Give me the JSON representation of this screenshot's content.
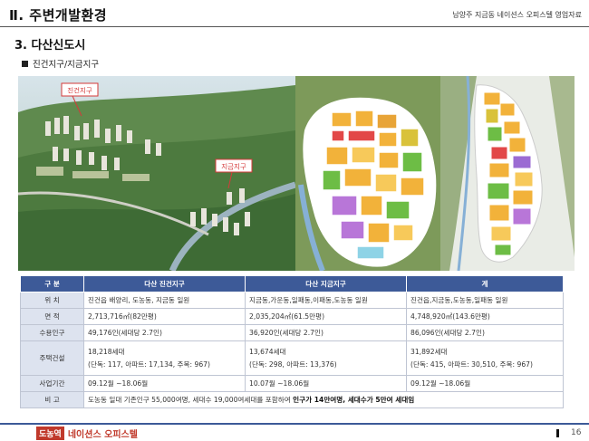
{
  "header": {
    "title": "Ⅱ.  주변개발환경",
    "subtitle": "남양주 지금동 네이션스 오피스텔 영업자료"
  },
  "section": {
    "title": "3. 다산신도시",
    "subsection": "진건지구/지금지구"
  },
  "map_labels": {
    "jingeon": "진건지구",
    "jigeum": "지금지구"
  },
  "table": {
    "headers": [
      "구  분",
      "다산 진건지구",
      "다산 지금지구",
      "계"
    ],
    "rows": [
      {
        "label": "위  치",
        "cells": [
          "진건읍 배양리, 도농동, 지금동 일원",
          "지금동,가운동,일패동,이패동,도농동  일원",
          "진건읍,지금동,도농동,일패동  일원"
        ]
      },
      {
        "label": "면  적",
        "cells": [
          "2,713,716㎡(82만평)",
          "2,035,204㎡(61.5만평)",
          "4,748,920㎡(143.6만평)"
        ]
      },
      {
        "label": "수용인구",
        "cells": [
          "49,176인(세대당  2.7인)",
          "36,920인(세대당  2.7인)",
          "86,096인(세대당  2.7인)"
        ]
      },
      {
        "label": "주택건설",
        "cells": [
          {
            "line1": "18,218세대",
            "line2": "(단독: 117,  아파트: 17,134,  주복: 967)"
          },
          {
            "line1": "13,674세대",
            "line2": "(단독: 298,  아파트: 13,376)"
          },
          {
            "line1": "31,892세대",
            "line2": "(단독: 415,  아파트: 30,510,  주복: 967)"
          }
        ]
      },
      {
        "label": "사업기간",
        "cells": [
          "09.12월  ~18.06월",
          "10.07월  ~18.06월",
          "09.12월  ~18.06월"
        ]
      },
      {
        "label": "비  고",
        "note_plain": "도농동 일대 기존인구 55,000여명,  세대수 19,000여세대를 포함하여 ",
        "note_bold": "인구가 14만여명, 세대수가 5만여 세대임"
      }
    ]
  },
  "footer": {
    "tag": "도농역",
    "brand": "네이션스 오피스텔",
    "page": "16"
  },
  "colors": {
    "table_header": "#3d5a98",
    "row_header": "#dde3ef",
    "brand_red": "#c0392b"
  }
}
